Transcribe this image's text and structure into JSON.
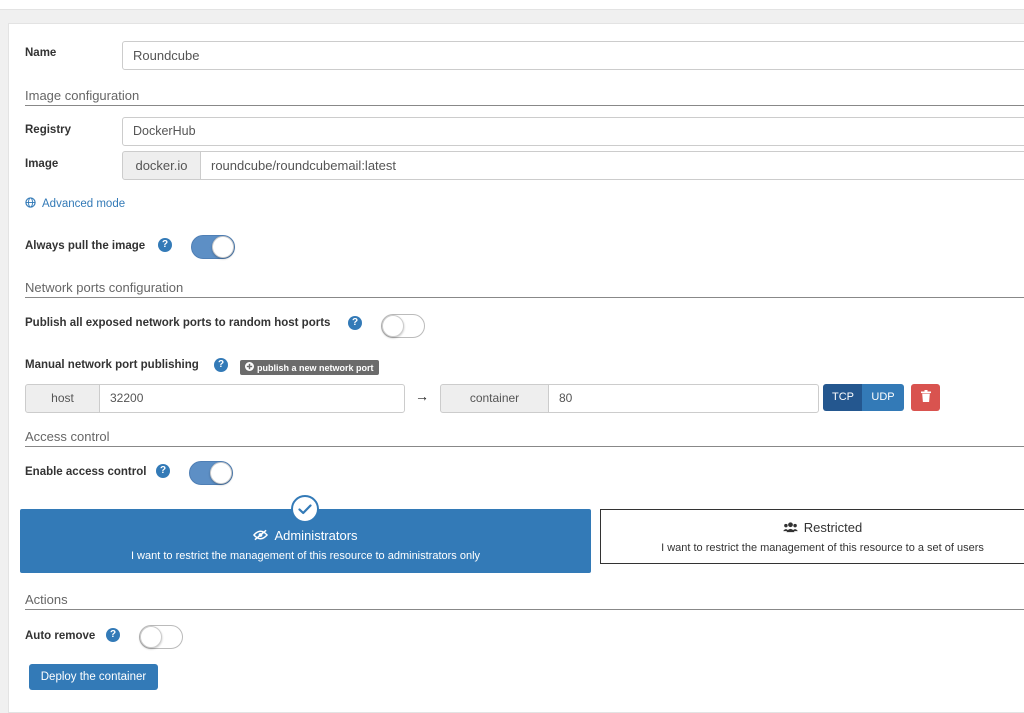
{
  "form": {
    "name_label": "Name",
    "name_value": "Roundcube",
    "image_section": "Image configuration",
    "registry_label": "Registry",
    "registry_value": "DockerHub",
    "image_label": "Image",
    "image_prefix": "docker.io",
    "image_value": "roundcube/roundcubemail:latest",
    "advanced_mode": "Advanced mode",
    "always_pull_label": "Always pull the image",
    "always_pull_on": true
  },
  "ports": {
    "section": "Network ports configuration",
    "publish_all_label": "Publish all exposed network ports to random host ports",
    "publish_all_on": false,
    "manual_label": "Manual network port publishing",
    "publish_new_button": "publish a new network port",
    "host_label": "host",
    "host_value": "32200",
    "arrow": "→",
    "container_label": "container",
    "container_value": "80",
    "tcp": "TCP",
    "udp": "UDP",
    "selected_protocol": "TCP"
  },
  "access": {
    "section": "Access control",
    "enable_label": "Enable access control",
    "enable_on": true,
    "admin_title": "Administrators",
    "admin_desc": "I want to restrict the management of this resource to administrators only",
    "restricted_title": "Restricted",
    "restricted_desc": "I want to restrict the management of this resource to a set of users",
    "selected": "Administrators"
  },
  "actions": {
    "section": "Actions",
    "auto_remove_label": "Auto remove",
    "auto_remove_on": false,
    "deploy_button": "Deploy the container"
  },
  "icons": {
    "help": "question-circle-icon",
    "globe": "globe-icon",
    "plus": "plus-circle-icon",
    "trash": "trash-icon",
    "check": "check-circle-icon",
    "eye_slash": "eye-slash-icon",
    "users": "users-icon"
  },
  "colors": {
    "primary": "#337ab7",
    "selected_card": "#337ab7",
    "danger": "#d9534f",
    "dark_grey": "#6b6b6b",
    "toggle_on": "#5d8fc5"
  }
}
